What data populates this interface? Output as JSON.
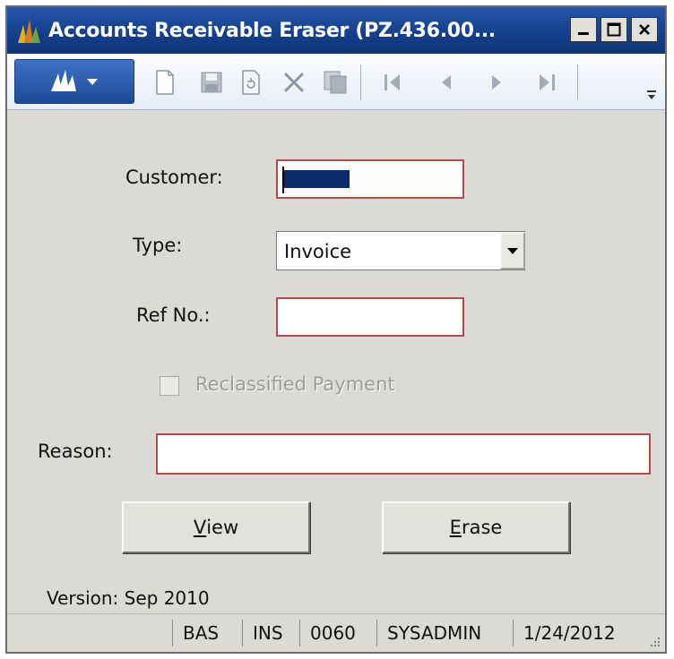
{
  "window": {
    "title": "Accounts Receivable Eraser (PZ.436.00...",
    "minimize_icon": "minimize-icon",
    "maximize_icon": "maximize-icon",
    "close_icon": "close-icon"
  },
  "toolbar": {
    "menu_icon": "app-menu-icon",
    "icons": [
      "new-icon",
      "save-icon",
      "refresh-icon",
      "delete-icon",
      "copy-icon",
      "first-record-icon",
      "previous-record-icon",
      "next-record-icon",
      "last-record-icon",
      "overflow-icon"
    ]
  },
  "form": {
    "customer_label": "Customer:",
    "customer_value": "",
    "type_label": "Type:",
    "type_value": "Invoice",
    "refno_label": "Ref No.:",
    "refno_value": "",
    "reclassified_label": "Reclassified Payment",
    "reclassified_checked": false,
    "reason_label": "Reason:",
    "reason_value": ""
  },
  "buttons": {
    "view_underline": "V",
    "view_rest": "iew",
    "erase_underline": "E",
    "erase_rest": "rase"
  },
  "version": "Version: Sep 2010",
  "status": {
    "company": "BAS",
    "mode": "INS",
    "code": "0060",
    "user": "SYSADMIN",
    "date": "1/24/2012"
  },
  "colors": {
    "titlebar": "#143e8a",
    "required_border": "#b64a4a",
    "selection": "#0a2b6e"
  }
}
